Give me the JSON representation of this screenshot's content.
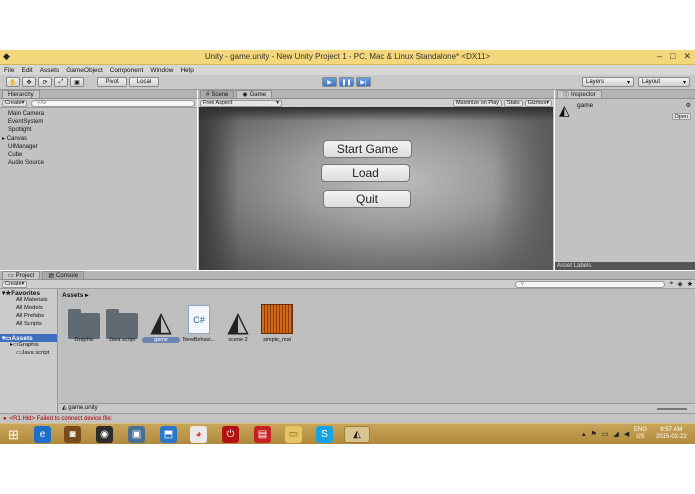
{
  "window": {
    "title": "Unity - game.unity - New Unity Project 1 - PC, Mac & Linux Standalone* <DX11>",
    "controls": [
      "–",
      "□",
      "✕"
    ]
  },
  "menu": [
    "File",
    "Edit",
    "Assets",
    "GameObject",
    "Component",
    "Window",
    "Help"
  ],
  "toolbar": {
    "pivot_label": "Pivot",
    "local_label": "Local",
    "layers_label": "Layers",
    "layout_label": "Layout"
  },
  "hierarchy": {
    "tab_label": "Hierarchy",
    "create_label": "Create",
    "search_placeholder": "All",
    "items": [
      "Main Camera",
      "EventSystem",
      "Spotlight",
      "Canvas",
      "UIManager",
      "Cube",
      "Audio Source"
    ]
  },
  "scene_tab": "Scene",
  "game_tab": "Game",
  "game_toolbar": {
    "aspect": "Free Aspect",
    "maximize": "Maximize on Play",
    "stats": "Stats",
    "gizmos": "Gizmos"
  },
  "game_buttons": {
    "start": "Start Game",
    "load": "Load",
    "quit": "Quit"
  },
  "inspector": {
    "tab_label": "Inspector",
    "object_name": "game",
    "open_label": "Open",
    "asset_labels": "Asset Labels"
  },
  "project": {
    "tab_label": "Project",
    "console_tab": "Console",
    "create_label": "Create",
    "favorites_label": "Favorites",
    "favorites": [
      "All Materials",
      "All Models",
      "All Prefabs",
      "All Scripts"
    ],
    "assets_label": "Assets",
    "asset_folders": [
      "Graphis",
      "Java script"
    ],
    "breadcrumb": "Assets",
    "assets": [
      "Graphis",
      "Java script",
      "game",
      "NewBehavi...",
      "scene 2",
      "simple_mai"
    ],
    "footer_file": "game.unity"
  },
  "status_bar": {
    "message": "<R1.Hid> Failed to connect device file:"
  },
  "taskbar": {
    "lang": "ENG",
    "region": "US",
    "time": "9:57 AM",
    "date": "2015-02-22"
  }
}
